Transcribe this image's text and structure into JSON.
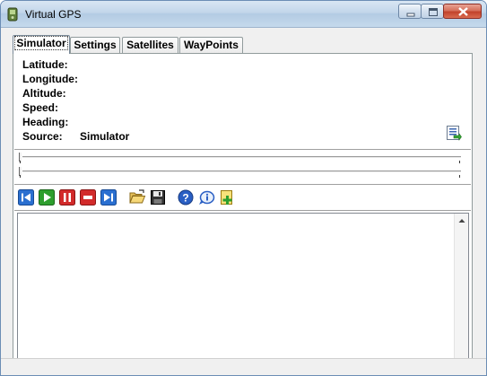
{
  "window": {
    "title": "Virtual GPS"
  },
  "tabs": [
    {
      "label": "Simulator",
      "active": true
    },
    {
      "label": "Settings",
      "active": false
    },
    {
      "label": "Satellites",
      "active": false
    },
    {
      "label": "WayPoints",
      "active": false
    }
  ],
  "info": {
    "rows": [
      {
        "label": "Latitude:",
        "value": ""
      },
      {
        "label": "Longitude:",
        "value": ""
      },
      {
        "label": "Altitude:",
        "value": ""
      },
      {
        "label": "Speed:",
        "value": ""
      },
      {
        "label": "Heading:",
        "value": ""
      },
      {
        "label": "Source:",
        "value": "Simulator"
      }
    ]
  },
  "toolbar": {
    "icons": [
      "skip-back-icon",
      "play-icon",
      "pause-icon",
      "stop-icon",
      "skip-forward-icon",
      "open-folder-icon",
      "save-icon",
      "help-icon",
      "about-icon",
      "add-icon"
    ]
  },
  "colors": {
    "titlebar": "#c2d6ea",
    "play": "#2e9e2e",
    "stop": "#d22b2b",
    "nav": "#2a6fd0"
  }
}
